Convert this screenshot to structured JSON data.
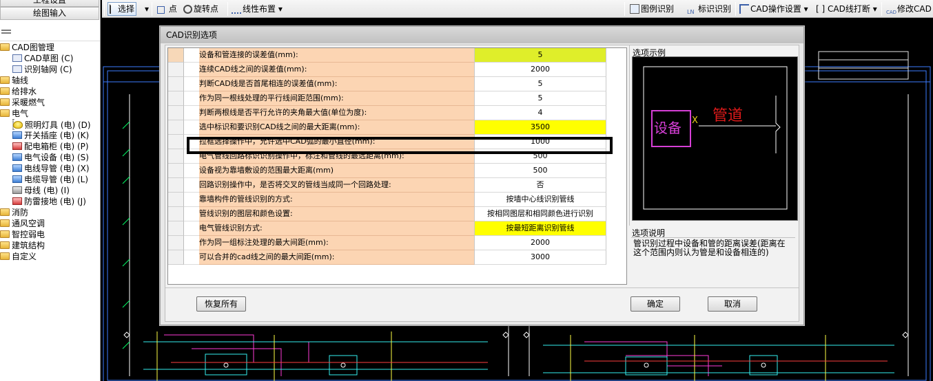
{
  "left_panel": {
    "top_button": "工程设置",
    "draw_button": "绘图输入",
    "tree": [
      {
        "label": "CAD图管理",
        "icon": "folder-icon",
        "indent": 0
      },
      {
        "label": "CAD草图 (C)",
        "icon": "cad-drawing-icon",
        "indent": 1
      },
      {
        "label": "识别轴网 (C)",
        "icon": "axis-grid-icon",
        "indent": 1
      },
      {
        "label": "轴线",
        "icon": "folder-icon",
        "indent": 0
      },
      {
        "label": "给排水",
        "icon": "folder-icon",
        "indent": 0
      },
      {
        "label": "采暖燃气",
        "icon": "folder-icon",
        "indent": 0
      },
      {
        "label": "电气",
        "icon": "folder-icon",
        "indent": 0
      },
      {
        "label": "照明灯具 (电) (D)",
        "icon": "light-bulb-icon",
        "indent": 1,
        "selected": true
      },
      {
        "label": "开关插座 (电) (K)",
        "icon": "switch-icon",
        "indent": 1
      },
      {
        "label": "配电箱柜 (电) (P)",
        "icon": "distribution-box-icon",
        "indent": 1
      },
      {
        "label": "电气设备 (电) (S)",
        "icon": "electrical-device-icon",
        "indent": 1
      },
      {
        "label": "电线导管 (电) (X)",
        "icon": "wire-conduit-icon",
        "indent": 1
      },
      {
        "label": "电缆导管 (电) (L)",
        "icon": "cable-conduit-icon",
        "indent": 1
      },
      {
        "label": "母线 (电) (I)",
        "icon": "busbar-icon",
        "indent": 1
      },
      {
        "label": "防雷接地 (电) (J)",
        "icon": "lightning-ground-icon",
        "indent": 1
      },
      {
        "label": "消防",
        "icon": "folder-icon",
        "indent": 0
      },
      {
        "label": "通风空调",
        "icon": "folder-icon",
        "indent": 0
      },
      {
        "label": "智控弱电",
        "icon": "folder-icon",
        "indent": 0
      },
      {
        "label": "建筑结构",
        "icon": "folder-icon",
        "indent": 0
      },
      {
        "label": "自定义",
        "icon": "folder-icon",
        "indent": 0
      }
    ]
  },
  "toolbar": {
    "select": "选择",
    "point": "点",
    "rotate_point": "旋转点",
    "linear_layout": "线性布置",
    "legend_recognize": "图例识别",
    "label_recognize": "标识识别",
    "cad_settings": "CAD操作设置",
    "cad_break": "CAD线打断",
    "modify_cad": "修改CAD"
  },
  "dialog": {
    "title": "CAD识别选项",
    "rows": [
      {
        "label": "设备和管连接的误差值(mm):",
        "value": "5",
        "highlight": "hl"
      },
      {
        "label": "连续CAD线之间的误差值(mm):",
        "value": "2000",
        "highlight": ""
      },
      {
        "label": "判断CAD线是否首尾相连的误差值(mm):",
        "value": "5",
        "highlight": ""
      },
      {
        "label": "作为同一根线处理的平行线间距范围(mm):",
        "value": "5",
        "highlight": ""
      },
      {
        "label": "判断两根线是否平行允许的夹角最大值(单位为度):",
        "value": "4",
        "highlight": ""
      },
      {
        "label": "选中标识和要识别CAD线之间的最大距离(mm):",
        "value": "3500",
        "highlight": "yl"
      },
      {
        "label": "拉框选择操作中，允许选中CAD弧的最小直径(mm):",
        "value": "1000",
        "highlight": ""
      },
      {
        "label": "电气管线回路标识识别操作中，标注和管线的最远距离(mm):",
        "value": "500",
        "highlight": ""
      },
      {
        "label": "设备视为靠墙敷设的范围最大距离(mm)",
        "value": "500",
        "highlight": ""
      },
      {
        "label": "回路识别操作中，是否将交叉的管线当成同一个回路处理:",
        "value": "否",
        "highlight": ""
      },
      {
        "label": "靠墙构件的管线识别的方式:",
        "value": "按墙中心线识别管线",
        "highlight": ""
      },
      {
        "label": "管线识别的图层和颜色设置:",
        "value": "按相同图层和相同颜色进行识别",
        "highlight": ""
      },
      {
        "label": "电气管线识别方式:",
        "value": "按最短距离识别管线",
        "highlight": "yl"
      },
      {
        "label": "作为同一组标注处理的最大间距(mm):",
        "value": "2000",
        "highlight": ""
      },
      {
        "label": "可以合并的cad线之间的最大间距(mm):",
        "value": "3000",
        "highlight": ""
      }
    ],
    "preview_label": "选项示例",
    "preview_device": "设备",
    "preview_x": "X",
    "preview_pipe": "管道",
    "description_label": "选项说明",
    "description": "管识别过程中设备和管的距离误差(距离在这个范围内则认为管是和设备相连的)",
    "restore_button": "恢复所有",
    "ok_button": "确定",
    "cancel_button": "取消"
  },
  "colors": {
    "label_bg": "#fcd5b3",
    "value_highlight_green": "#dfee2a",
    "value_highlight_yellow": "#ffff00",
    "cad_background": "#000000",
    "preview_device": "#d63fd6",
    "preview_pipe": "#e01a1a"
  }
}
